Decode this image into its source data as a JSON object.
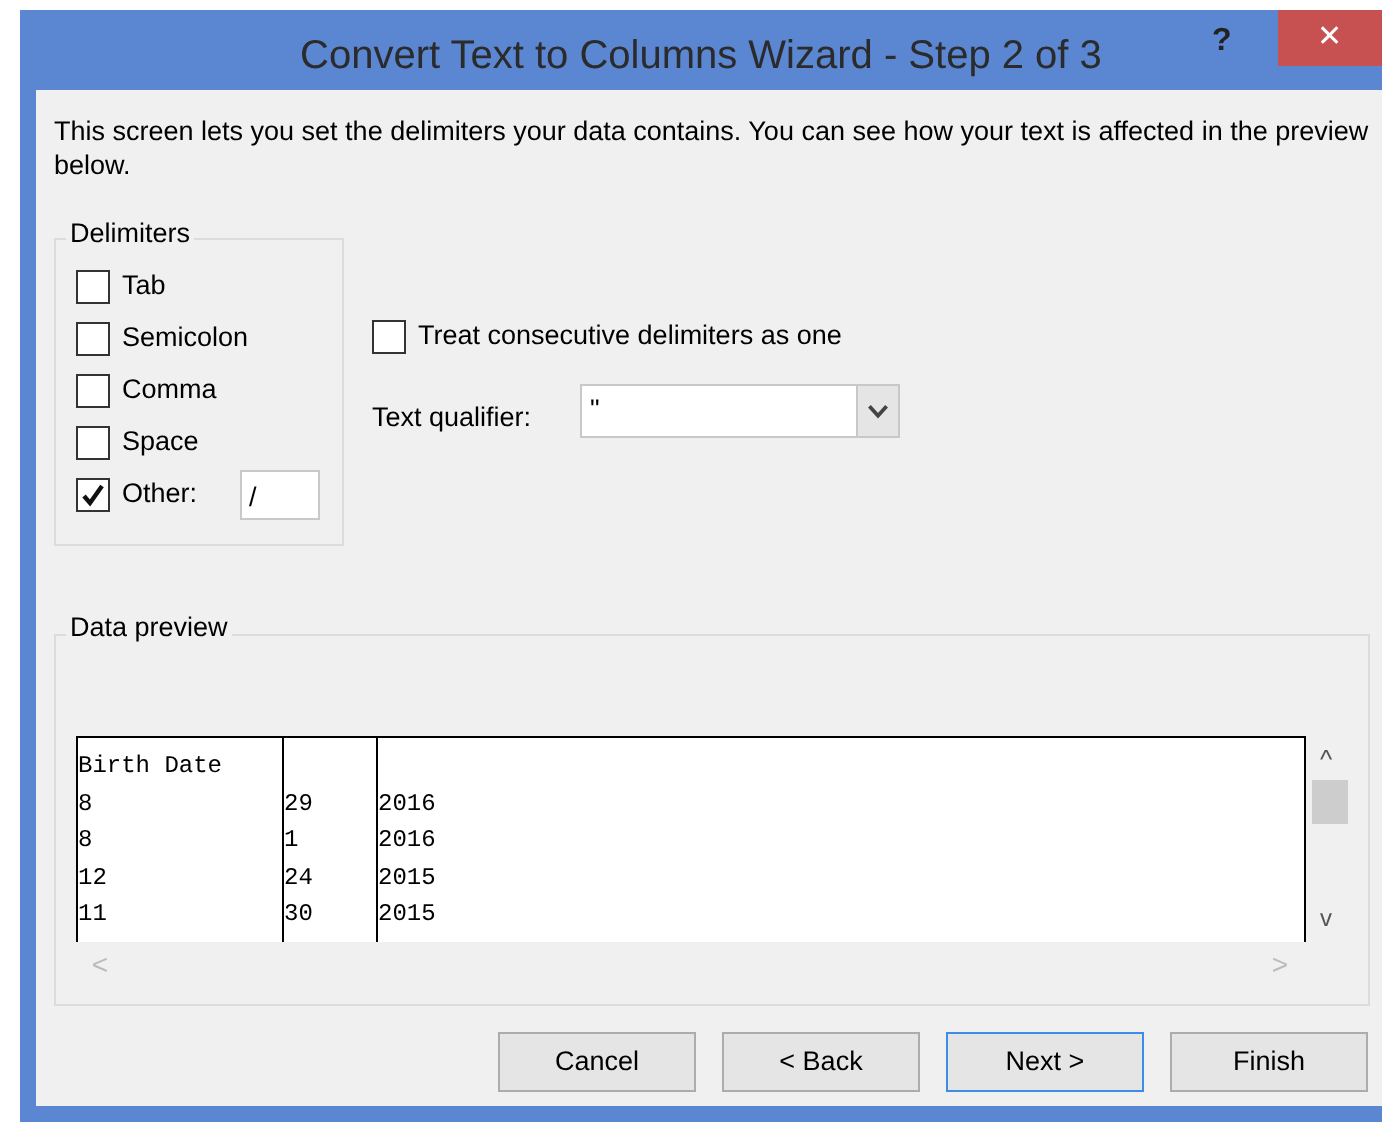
{
  "window": {
    "title": "Convert Text to Columns Wizard - Step 2 of 3",
    "help": "?",
    "close": "✕"
  },
  "description": "This screen lets you set the delimiters your data contains.  You can see how your text is affected in the preview below.",
  "delimiters": {
    "title": "Delimiters",
    "items": [
      {
        "label": "Tab",
        "checked": false
      },
      {
        "label": "Semicolon",
        "checked": false
      },
      {
        "label": "Comma",
        "checked": false
      },
      {
        "label": "Space",
        "checked": false
      },
      {
        "label": "Other:",
        "checked": true,
        "value": "/"
      }
    ]
  },
  "consecutive": {
    "label": "Treat consecutive delimiters as one",
    "checked": false
  },
  "text_qualifier": {
    "label": "Text qualifier:",
    "value": "\""
  },
  "data_preview": {
    "title": "Data preview",
    "rows": [
      [
        "Birth Date",
        "",
        ""
      ],
      [
        "8",
        "29",
        "2016"
      ],
      [
        "8",
        "1",
        "2016"
      ],
      [
        "12",
        "24",
        "2015"
      ],
      [
        "11",
        "30",
        "2015"
      ]
    ],
    "scroll_up": "^",
    "scroll_down": "v",
    "scroll_left": "<",
    "scroll_right": ">"
  },
  "buttons": [
    {
      "label": "Cancel",
      "selected": false
    },
    {
      "label": "< Back",
      "selected": false
    },
    {
      "label": "Next >",
      "selected": true
    },
    {
      "label": "Finish",
      "selected": false
    }
  ]
}
